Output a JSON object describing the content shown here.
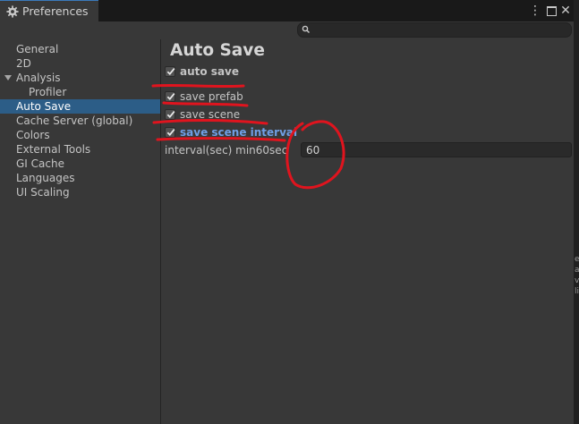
{
  "window": {
    "tab_title": "Preferences",
    "tab_icon": "gear-icon",
    "accent_color": "#3a79bb",
    "selection_color": "#2c5d87",
    "highlight_text_color": "#6f9fe5",
    "annotation_color": "#e0141e"
  },
  "search": {
    "placeholder": "",
    "value": ""
  },
  "sidebar": {
    "items": [
      {
        "label": "General"
      },
      {
        "label": "2D"
      },
      {
        "label": "Analysis",
        "expanded": true
      },
      {
        "label": "Profiler"
      },
      {
        "label": "Auto Save",
        "selected": true
      },
      {
        "label": "Cache Server (global)"
      },
      {
        "label": "Colors"
      },
      {
        "label": "External Tools"
      },
      {
        "label": "GI Cache"
      },
      {
        "label": "Languages"
      },
      {
        "label": "UI Scaling"
      }
    ]
  },
  "main": {
    "title": "Auto Save",
    "toggles": [
      {
        "label": "auto save",
        "checked": true
      },
      {
        "label": "save prefab",
        "checked": true
      },
      {
        "label": "save scene",
        "checked": true
      },
      {
        "label": "save scene interval",
        "checked": true
      }
    ],
    "interval": {
      "label": "interval(sec) min60sec",
      "value": "60"
    }
  },
  "gutter": {
    "text": "e\na\nv\nli"
  }
}
